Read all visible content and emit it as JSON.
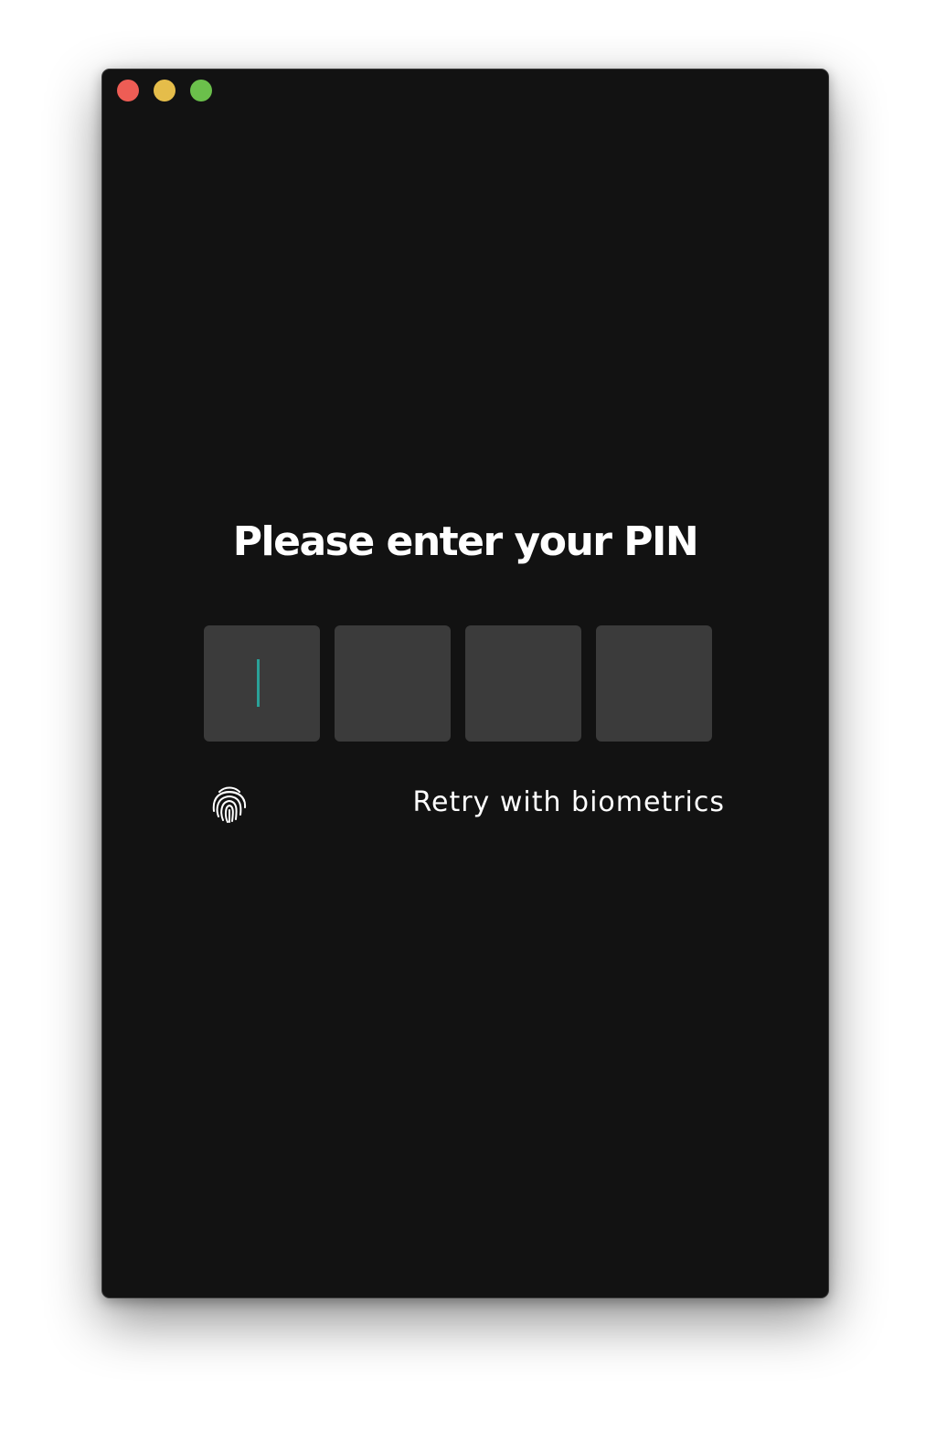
{
  "window": {
    "controls": [
      "close",
      "minimize",
      "zoom"
    ],
    "control_colors": {
      "close": "#ee5d55",
      "minimize": "#e5bd4a",
      "zoom": "#6bc04b"
    },
    "background": "#121212"
  },
  "pin": {
    "title": "Please enter your PIN",
    "digits": [
      "",
      "",
      "",
      ""
    ],
    "focused_index": 0,
    "box_color": "#3b3b3b",
    "cursor_color": "#2aa198"
  },
  "biometrics": {
    "icon": "fingerprint-icon",
    "label": "Retry with biometrics"
  }
}
